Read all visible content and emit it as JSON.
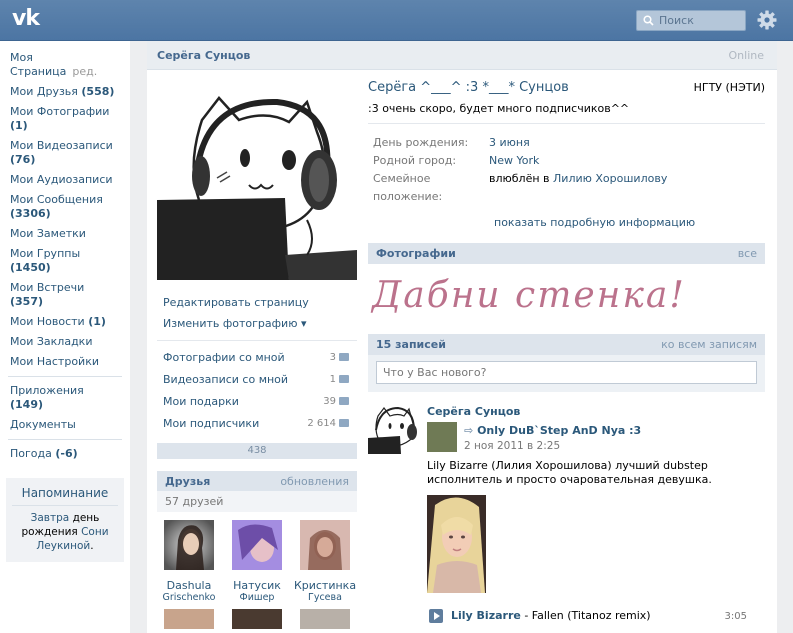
{
  "header": {
    "logo": "vk",
    "search_placeholder": "Поиск",
    "accent": "#4c75a3"
  },
  "sidebar": {
    "items": [
      {
        "label": "Моя Страница",
        "extra": "ред."
      },
      {
        "label": "Мои Друзья",
        "count": "(558)"
      },
      {
        "label": "Мои Фотографии",
        "count": "(1)"
      },
      {
        "label": "Мои Видеозаписи",
        "count": "(76)"
      },
      {
        "label": "Мои Аудиозаписи",
        "count": ""
      },
      {
        "label": "Мои Сообщения",
        "count": "(3306)"
      },
      {
        "label": "Мои Заметки",
        "count": ""
      },
      {
        "label": "Мои Группы",
        "count": "(1450)"
      },
      {
        "label": "Мои Встречи",
        "count": "(357)"
      },
      {
        "label": "Мои Новости",
        "count": "(1)"
      },
      {
        "label": "Мои Закладки",
        "count": ""
      },
      {
        "label": "Мои Настройки",
        "count": ""
      }
    ],
    "items2": [
      {
        "label": "Приложения",
        "count": "(149)"
      },
      {
        "label": "Документы",
        "count": ""
      }
    ],
    "weather": {
      "label": "Погода",
      "count": "(-6)"
    },
    "reminder": {
      "title": "Напоминание",
      "text_pre": "Завтра ",
      "text_mid": "день рождения ",
      "name": "Сони Леукиной",
      "text_post": "."
    }
  },
  "profile": {
    "header_name": "Серёга Сунцов",
    "online": "Online",
    "full_name": "Серёга ^___^ :3 *___* Сунцов",
    "university": "НГТУ (НЭТИ)",
    "status": ":3 очень скоро, будет много подписчиков^^",
    "info": [
      {
        "label": "День рождения:",
        "value": "3 июня"
      },
      {
        "label": "Родной город:",
        "value": "New York"
      },
      {
        "label": "Семейное положение:",
        "value_plain": "влюблён в ",
        "value": "Лилию Хорошилову"
      }
    ],
    "more_info": "показать подробную информацию",
    "actions": [
      "Редактировать страницу",
      "Изменить фотографию ▾"
    ],
    "stats": [
      {
        "label": "Фотографии со мной",
        "count": "3",
        "icon": "camera-icon"
      },
      {
        "label": "Видеозаписи со мной",
        "count": "1",
        "icon": "film-icon"
      },
      {
        "label": "Мои подарки",
        "count": "39",
        "icon": "gift-icon"
      },
      {
        "label": "Мои подписчики",
        "count": "2 614",
        "icon": "people-icon"
      }
    ],
    "rating": "438",
    "friends": {
      "title": "Друзья",
      "updates": "обновления",
      "count": "57 друзей",
      "list": [
        {
          "name": "Dashula",
          "sub": "Grischenko"
        },
        {
          "name": "Натусик",
          "sub": "Фишер"
        },
        {
          "name": "Кристинка",
          "sub": "Гусева"
        }
      ]
    }
  },
  "photos": {
    "title": "Фотографии",
    "all": "все",
    "strip_text": "Дабни  стенка!"
  },
  "wall": {
    "title": "15 записей",
    "all": "ко всем записям",
    "placeholder": "Что у Вас нового?",
    "post": {
      "author": "Серёга Сунцов",
      "repost_name": "Only DuB`Step AnD Nya :3",
      "date": "2 ноя 2011 в 2:25",
      "text": "Lily Bizarre (Лилия Хорошилова) лучший dubstep исполнитель и просто очаровательная девушка.",
      "audio_artist": "Lily Bizarre",
      "audio_title": " - Fallen (Titanoz remix)",
      "audio_duration": "3:05"
    }
  }
}
